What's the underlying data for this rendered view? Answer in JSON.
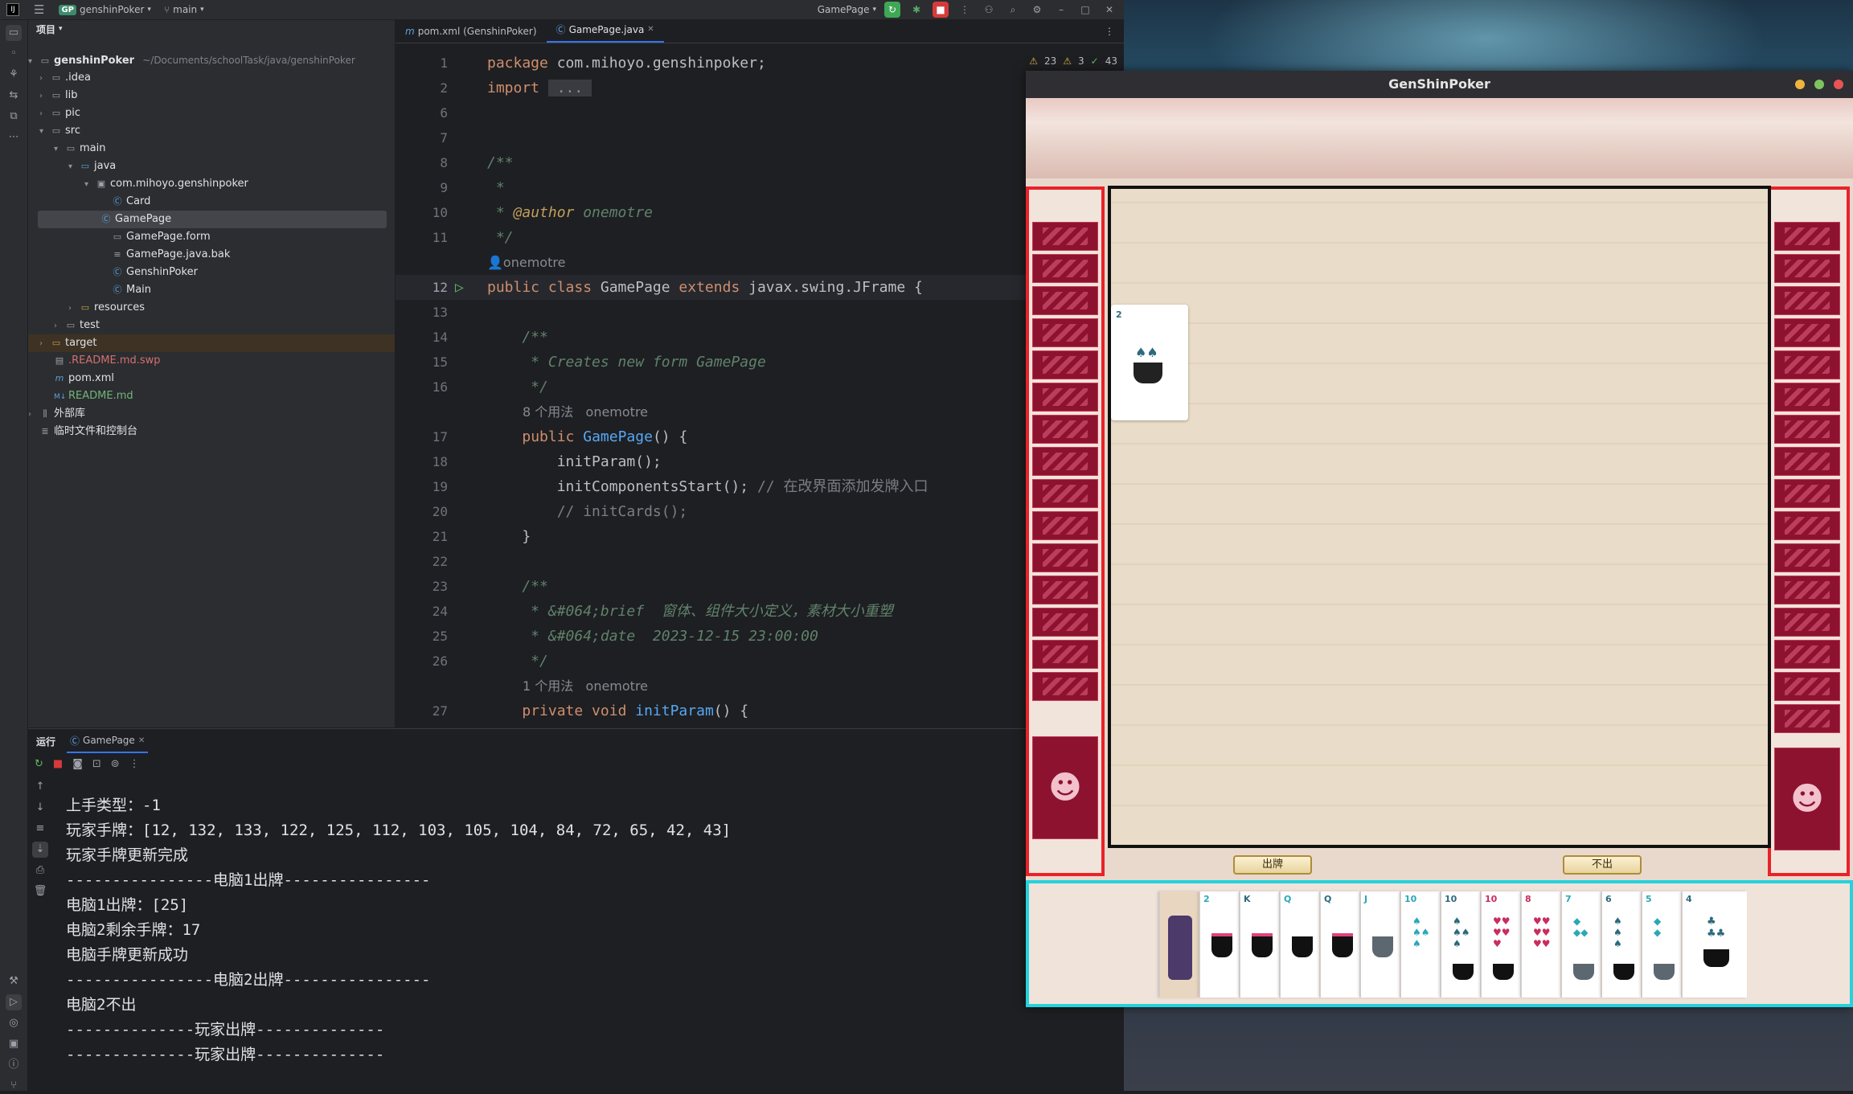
{
  "titlebar": {
    "project_badge": "GP",
    "project_name": "genshinPoker",
    "branch": "main",
    "run_config": "GamePage"
  },
  "project_panel": {
    "title": "项目",
    "root_name": "genshinPoker",
    "root_path": "~/Documents/schoolTask/java/genshinPoker",
    "items": [
      {
        "label": ".idea",
        "type": "folder"
      },
      {
        "label": "lib",
        "type": "folder"
      },
      {
        "label": "pic",
        "type": "folder"
      },
      {
        "label": "src",
        "type": "folder"
      },
      {
        "label": "main",
        "type": "folder"
      },
      {
        "label": "java",
        "type": "folder"
      },
      {
        "label": "com.mihoyo.genshinpoker",
        "type": "package"
      },
      {
        "label": "Card",
        "type": "class"
      },
      {
        "label": "GamePage",
        "type": "class"
      },
      {
        "label": "GamePage.form",
        "type": "form"
      },
      {
        "label": "GamePage.java.bak",
        "type": "file"
      },
      {
        "label": "GenshinPoker",
        "type": "class"
      },
      {
        "label": "Main",
        "type": "class"
      },
      {
        "label": "resources",
        "type": "folder"
      },
      {
        "label": "test",
        "type": "folder"
      },
      {
        "label": "target",
        "type": "folder"
      },
      {
        "label": ".README.md.swp",
        "type": "file"
      },
      {
        "label": "pom.xml",
        "type": "maven"
      },
      {
        "label": "README.md",
        "type": "markdown"
      },
      {
        "label": "外部库",
        "type": "library"
      },
      {
        "label": "临时文件和控制台",
        "type": "scratch"
      }
    ]
  },
  "editor": {
    "tabs": [
      {
        "label": "pom.xml (GenshinPoker)",
        "active": false
      },
      {
        "label": "GamePage.java",
        "active": true
      }
    ],
    "inspections": {
      "warnings": "23",
      "weak_warnings": "3",
      "ok": "43"
    },
    "lines": [
      {
        "n": "1",
        "text": "package com.mihoyo.genshinpoker;"
      },
      {
        "n": "2",
        "text": "import ..."
      },
      {
        "n": "6",
        "text": ""
      },
      {
        "n": "7",
        "text": ""
      },
      {
        "n": "8",
        "text": "/**"
      },
      {
        "n": "9",
        "text": " *"
      },
      {
        "n": "10",
        "text": " * @author onemotre"
      },
      {
        "n": "11",
        "text": " */"
      },
      {
        "n": "",
        "text": "onemotre"
      },
      {
        "n": "12",
        "text": "public class GamePage extends javax.swing.JFrame {"
      },
      {
        "n": "13",
        "text": ""
      },
      {
        "n": "14",
        "text": "    /**"
      },
      {
        "n": "15",
        "text": "     * Creates new form GamePage"
      },
      {
        "n": "16",
        "text": "     */"
      },
      {
        "n": "",
        "text": "8 个用法   onemotre"
      },
      {
        "n": "17",
        "text": "    public GamePage() {"
      },
      {
        "n": "18",
        "text": "        initParam();"
      },
      {
        "n": "19",
        "text": "        initComponentsStart(); // 在改界面添加发牌入口"
      },
      {
        "n": "20",
        "text": "        // initCards();"
      },
      {
        "n": "21",
        "text": "    }"
      },
      {
        "n": "22",
        "text": ""
      },
      {
        "n": "23",
        "text": "    /**"
      },
      {
        "n": "24",
        "text": "     * &#064;brief  窗体、组件大小定义，素材大小重塑"
      },
      {
        "n": "25",
        "text": "     * &#064;date  2023-12-15 23:00:00"
      },
      {
        "n": "26",
        "text": "     */"
      },
      {
        "n": "",
        "text": "1 个用法   onemotre"
      },
      {
        "n": "27",
        "text": "    private void initParam() {"
      }
    ]
  },
  "run_panel": {
    "title": "运行",
    "tab": "GamePage",
    "output": [
      "上手类型：-1",
      "玩家手牌：[12, 132, 133, 122, 125, 112, 103, 105, 104, 84, 72, 65, 42, 43]",
      "玩家手牌更新完成",
      "----------------电脑1出牌----------------",
      "电脑1出牌：[25]",
      "电脑2剩余手牌：17",
      "电脑手牌更新成功",
      "----------------电脑2出牌----------------",
      "电脑2不出",
      "--------------玩家出牌--------------",
      "--------------玩家出牌--------------"
    ]
  },
  "game": {
    "window_title": "GenShinPoker",
    "play_button": "出牌",
    "pass_button": "不出",
    "played_card_rank": "2",
    "hand_ranks": [
      "",
      "2",
      "K",
      "Q",
      "Q",
      "J",
      "10",
      "10",
      "10",
      "8",
      "7",
      "6",
      "5",
      "4"
    ],
    "colors": {
      "player_border": "#24d2dc",
      "opponent_border": "#e8222b",
      "table_border": "#111111"
    }
  }
}
